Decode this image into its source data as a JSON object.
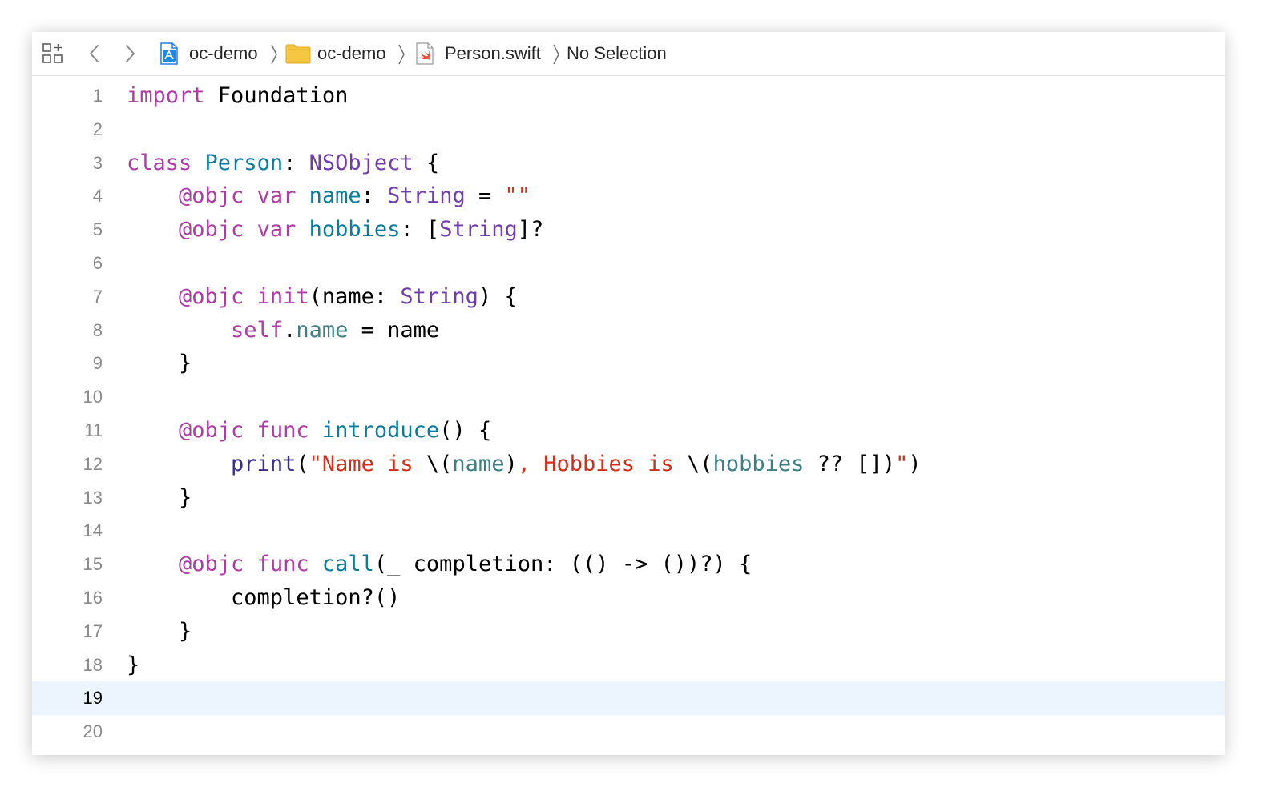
{
  "jumpbar": {
    "breadcrumbs": [
      {
        "label": "oc-demo",
        "icon": "xcode-project-icon"
      },
      {
        "label": "oc-demo",
        "icon": "folder-icon"
      },
      {
        "label": "Person.swift",
        "icon": "swift-file-icon"
      },
      {
        "label": "No Selection",
        "icon": ""
      }
    ]
  },
  "editor": {
    "current_line": 19,
    "lines": [
      {
        "n": "1",
        "tokens": [
          [
            "kw",
            "import"
          ],
          [
            "plain",
            " Foundation"
          ]
        ]
      },
      {
        "n": "2",
        "tokens": []
      },
      {
        "n": "3",
        "tokens": [
          [
            "kw",
            "class"
          ],
          [
            "plain",
            " "
          ],
          [
            "decl",
            "Person"
          ],
          [
            "plain",
            ": "
          ],
          [
            "type",
            "NSObject"
          ],
          [
            "plain",
            " {"
          ]
        ]
      },
      {
        "n": "4",
        "tokens": [
          [
            "plain",
            "    "
          ],
          [
            "kw",
            "@objc"
          ],
          [
            "plain",
            " "
          ],
          [
            "kw",
            "var"
          ],
          [
            "plain",
            " "
          ],
          [
            "decl",
            "name"
          ],
          [
            "plain",
            ": "
          ],
          [
            "type",
            "String"
          ],
          [
            "plain",
            " = "
          ],
          [
            "str",
            "\"\""
          ]
        ]
      },
      {
        "n": "5",
        "tokens": [
          [
            "plain",
            "    "
          ],
          [
            "kw",
            "@objc"
          ],
          [
            "plain",
            " "
          ],
          [
            "kw",
            "var"
          ],
          [
            "plain",
            " "
          ],
          [
            "decl",
            "hobbies"
          ],
          [
            "plain",
            ": ["
          ],
          [
            "type",
            "String"
          ],
          [
            "plain",
            "]?"
          ]
        ]
      },
      {
        "n": "6",
        "tokens": []
      },
      {
        "n": "7",
        "tokens": [
          [
            "plain",
            "    "
          ],
          [
            "kw",
            "@objc"
          ],
          [
            "plain",
            " "
          ],
          [
            "kw",
            "init"
          ],
          [
            "plain",
            "(name: "
          ],
          [
            "type",
            "String"
          ],
          [
            "plain",
            ") {"
          ]
        ]
      },
      {
        "n": "8",
        "tokens": [
          [
            "plain",
            "        "
          ],
          [
            "kw",
            "self"
          ],
          [
            "plain",
            "."
          ],
          [
            "prop",
            "name"
          ],
          [
            "plain",
            " = name"
          ]
        ]
      },
      {
        "n": "9",
        "tokens": [
          [
            "plain",
            "    }"
          ]
        ]
      },
      {
        "n": "10",
        "tokens": []
      },
      {
        "n": "11",
        "tokens": [
          [
            "plain",
            "    "
          ],
          [
            "kw",
            "@objc"
          ],
          [
            "plain",
            " "
          ],
          [
            "kw",
            "func"
          ],
          [
            "plain",
            " "
          ],
          [
            "decl",
            "introduce"
          ],
          [
            "plain",
            "() {"
          ]
        ]
      },
      {
        "n": "12",
        "tokens": [
          [
            "plain",
            "        "
          ],
          [
            "fn",
            "print"
          ],
          [
            "plain",
            "("
          ],
          [
            "str",
            "\"Name is "
          ],
          [
            "plain",
            "\\("
          ],
          [
            "prop",
            "name"
          ],
          [
            "plain",
            ")"
          ],
          [
            "str",
            ", Hobbies is "
          ],
          [
            "plain",
            "\\("
          ],
          [
            "prop",
            "hobbies"
          ],
          [
            "plain",
            " ?? [])"
          ],
          [
            "str",
            "\""
          ],
          [
            "plain",
            ")"
          ]
        ]
      },
      {
        "n": "13",
        "tokens": [
          [
            "plain",
            "    }"
          ]
        ]
      },
      {
        "n": "14",
        "tokens": []
      },
      {
        "n": "15",
        "tokens": [
          [
            "plain",
            "    "
          ],
          [
            "kw",
            "@objc"
          ],
          [
            "plain",
            " "
          ],
          [
            "kw",
            "func"
          ],
          [
            "plain",
            " "
          ],
          [
            "decl",
            "call"
          ],
          [
            "plain",
            "(_ completion: (() -> ())?) {"
          ]
        ]
      },
      {
        "n": "16",
        "tokens": [
          [
            "plain",
            "        completion?()"
          ]
        ]
      },
      {
        "n": "17",
        "tokens": [
          [
            "plain",
            "    }"
          ]
        ]
      },
      {
        "n": "18",
        "tokens": [
          [
            "plain",
            "}"
          ]
        ]
      },
      {
        "n": "19",
        "tokens": []
      },
      {
        "n": "20",
        "tokens": []
      }
    ]
  },
  "colors": {
    "keyword": "#ad3da4",
    "type": "#703daa",
    "declaration": "#0b7a9b",
    "property": "#3f7f82",
    "string": "#d12f1b",
    "function": "#3c2f8d",
    "current_line_bg": "#ecf5fe"
  }
}
